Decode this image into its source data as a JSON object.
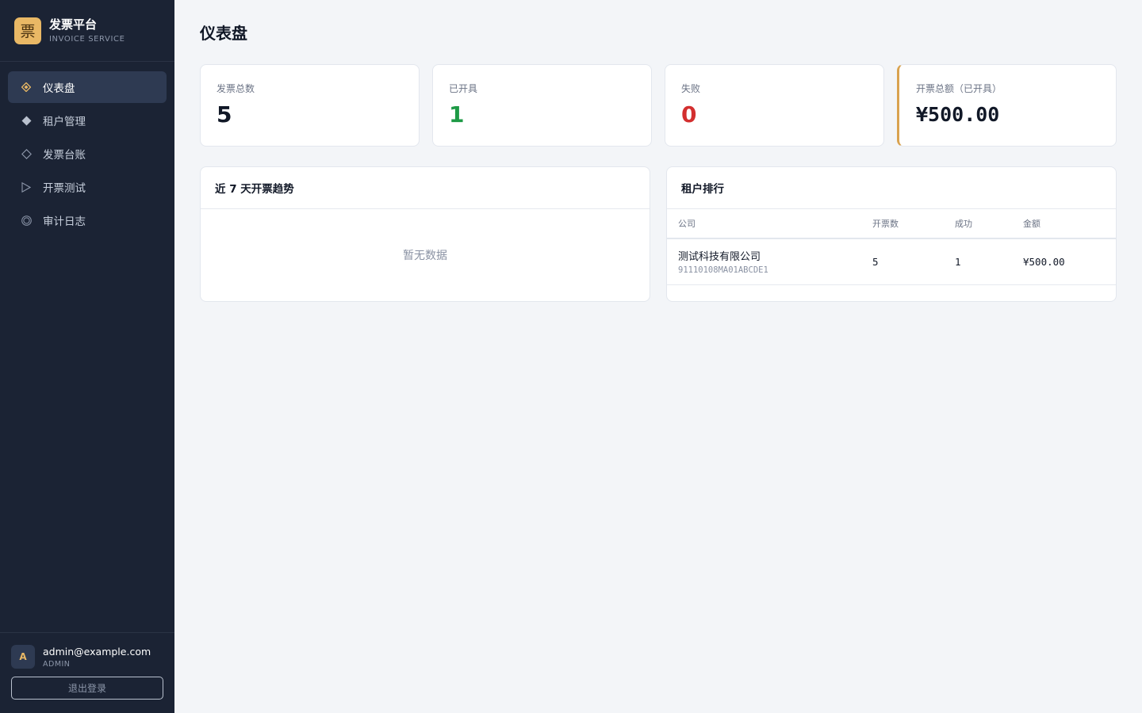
{
  "brand": {
    "logo_char": "票",
    "name": "发票平台",
    "subtitle": "INVOICE SERVICE"
  },
  "sidebar": {
    "items": [
      {
        "label": "仪表盘",
        "icon": "diamond-dot-icon",
        "active": true
      },
      {
        "label": "租户管理",
        "icon": "filled-diamond-icon",
        "active": false
      },
      {
        "label": "发票台账",
        "icon": "outline-diamond-icon",
        "active": false
      },
      {
        "label": "开票测试",
        "icon": "play-triangle-icon",
        "active": false
      },
      {
        "label": "审计日志",
        "icon": "circle-target-icon",
        "active": false
      }
    ]
  },
  "user": {
    "avatar_letter": "A",
    "email": "admin@example.com",
    "role": "ADMIN",
    "logout_label": "退出登录"
  },
  "page": {
    "title": "仪表盘"
  },
  "stats": [
    {
      "label": "发票总数",
      "value": "5"
    },
    {
      "label": "已开具",
      "value": "1"
    },
    {
      "label": "失败",
      "value": "0"
    },
    {
      "label": "开票总额（已开具）",
      "value": "¥500.00"
    }
  ],
  "trend_panel": {
    "title": "近 7 天开票趋势",
    "empty_text": "暂无数据"
  },
  "rank_panel": {
    "title": "租户排行",
    "columns": [
      "公司",
      "开票数",
      "成功",
      "金额"
    ],
    "rows": [
      {
        "company": "测试科技有限公司",
        "code": "91110108MA01ABCDE1",
        "count": "5",
        "success": "1",
        "amount": "¥500.00"
      }
    ]
  },
  "colors": {
    "sidebar_bg": "#1b2334",
    "accent_gold": "#e9b865",
    "success_green": "#1e9a46",
    "fail_red": "#d32f2f",
    "page_bg": "#f3f5f8"
  }
}
